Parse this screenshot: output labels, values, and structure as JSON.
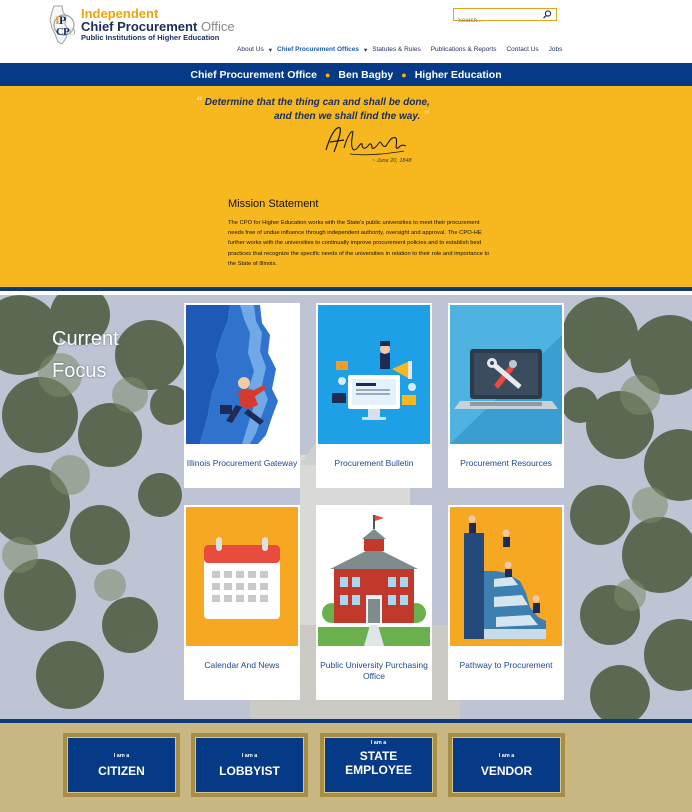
{
  "header": {
    "logo_line1": "Independent",
    "logo_line2a": "Chief Procurement",
    "logo_line2b": "Office",
    "logo_line3": "Public Institutions of Higher Education",
    "search_placeholder": "Search..."
  },
  "nav": {
    "items": [
      {
        "label": "About Us",
        "active": false
      },
      {
        "label": "Chief Procurement Offices",
        "active": true
      },
      {
        "label": "Statutes & Rules",
        "active": false
      },
      {
        "label": "Publications & Reports",
        "active": false
      },
      {
        "label": "Contact Us",
        "active": false
      },
      {
        "label": "Jobs",
        "active": false
      }
    ]
  },
  "banner": {
    "part1": "Chief Procurement Office",
    "part2": "Ben Bagby",
    "part3": "Higher Education"
  },
  "quote": {
    "line1": "Determine that the thing can and shall be done,",
    "line2": "and then we shall find the way.",
    "date": "~ June 20, 1848"
  },
  "mission": {
    "title": "Mission Statement",
    "lines": [
      "The CPO for Higher Education works with the State's public universities to meet their procurement",
      "needs free of undue influence through independent authority, oversight and approval. The CPO-HE",
      "further works with the universities to continually improve procurement policies and to establish best",
      "practices that recognize the specific needs of the universities in relation to their role and importance to",
      "the State of Illinois."
    ]
  },
  "focus": {
    "title_line1": "Current",
    "title_line2": "Focus",
    "cards": [
      {
        "label": "Illinois Procurement Gateway",
        "icon": "illinois-map-climber-icon"
      },
      {
        "label": "Procurement Bulletin",
        "icon": "bulletin-icon"
      },
      {
        "label": "Procurement Resources",
        "icon": "laptop-tools-icon"
      },
      {
        "label": "Calendar And News",
        "icon": "calendar-icon"
      },
      {
        "label": "Public University Purchasing Office",
        "icon": "university-building-icon"
      },
      {
        "label": "Pathway to Procurement",
        "icon": "spiral-stairs-icon"
      }
    ]
  },
  "roles": [
    {
      "small": "I am a",
      "big": "CITIZEN"
    },
    {
      "small": "I am a",
      "big": "LOBBYIST"
    },
    {
      "small": "I am a",
      "big": "STATE EMPLOYEE"
    },
    {
      "small": "I am a",
      "big": "VENDOR"
    }
  ],
  "colors": {
    "gold": "#f6b81e",
    "navy": "#073a86",
    "link_blue": "#1f4a8c",
    "tan": "#c8b783"
  }
}
